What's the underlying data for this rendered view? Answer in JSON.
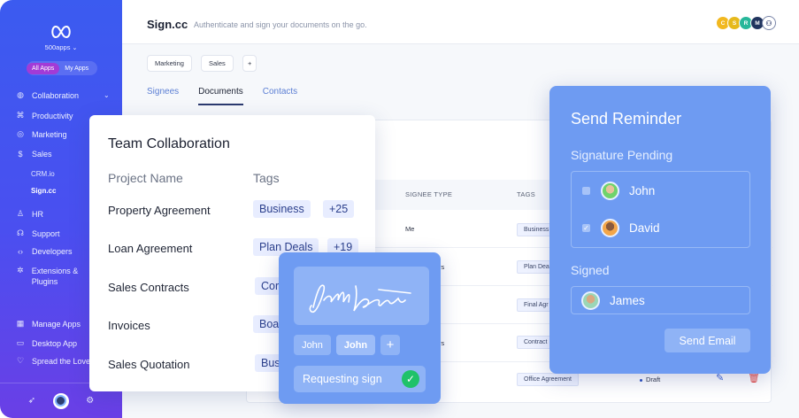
{
  "sidebar": {
    "org_name": "500apps",
    "apps_toggle": {
      "all": "All Apps",
      "mine": "My Apps"
    },
    "items": [
      {
        "label": "Collaboration",
        "icon": "globe-icon"
      },
      {
        "label": "Productivity",
        "icon": "command-icon"
      },
      {
        "label": "Marketing",
        "icon": "target-icon"
      },
      {
        "label": "Sales",
        "icon": "dollar-icon"
      },
      {
        "label": "HR",
        "icon": "person-icon"
      },
      {
        "label": "Support",
        "icon": "headset-icon"
      },
      {
        "label": "Developers",
        "icon": "code-icon"
      },
      {
        "label": "Extensions & Plugins",
        "icon": "puzzle-icon"
      },
      {
        "label": "Manage Apps",
        "icon": "grid-icon"
      },
      {
        "label": "Desktop App",
        "icon": "monitor-icon"
      },
      {
        "label": "Spread the Love",
        "icon": "heart-icon"
      }
    ],
    "sales_sub": [
      "CRM.io",
      "Sign.cc"
    ]
  },
  "header": {
    "title": "Sign.cc",
    "tagline": "Authenticate and sign your documents on the go.",
    "avatars": [
      "C",
      "S",
      "R",
      "M"
    ]
  },
  "filters": [
    "Marketing",
    "Sales",
    "+"
  ],
  "tabs": [
    "Signees",
    "Documents",
    "Contacts"
  ],
  "table": {
    "headers": {
      "signee_type": "SIGNEE TYPE",
      "tags": "TAGS"
    },
    "rows": [
      {
        "signee": "Me",
        "tag": "Business"
      },
      {
        "signee": "rs",
        "tag": "Plan Deals"
      },
      {
        "signee": "",
        "tag": "Final Agr"
      },
      {
        "signee": "rs",
        "tag": "Contract"
      },
      {
        "signee": "",
        "tag": "Office Agreement",
        "status": "Draft"
      }
    ]
  },
  "team_card": {
    "title": "Team Collaboration",
    "col_project": "Project Name",
    "col_tags": "Tags",
    "rows": [
      {
        "name": "Property Agreement",
        "tag": "Business",
        "extra": "+25"
      },
      {
        "name": "Loan Agreement",
        "tag": "Plan Deals",
        "extra": "+19"
      },
      {
        "name": "Sales Contracts",
        "tag": "Cor"
      },
      {
        "name": "Invoices",
        "tag": "Boa"
      },
      {
        "name": "Sales Quotation",
        "tag": "Bus"
      }
    ]
  },
  "sign_card": {
    "chips": [
      "John",
      "John",
      "+"
    ],
    "requesting": "Requesting sign"
  },
  "reminder": {
    "title": "Send Reminder",
    "pending_label": "Signature Pending",
    "pending": [
      "John",
      "David"
    ],
    "signed_label": "Signed",
    "signed": [
      "James"
    ],
    "send_button": "Send Email"
  },
  "colors": {
    "sidebar_top": "#3b5bf0",
    "sidebar_bottom": "#6a3fe6",
    "card_blue": "#6e9bf2",
    "accent_tab": "#5c7fd4",
    "success": "#1fc26a",
    "danger": "#e3413c"
  }
}
